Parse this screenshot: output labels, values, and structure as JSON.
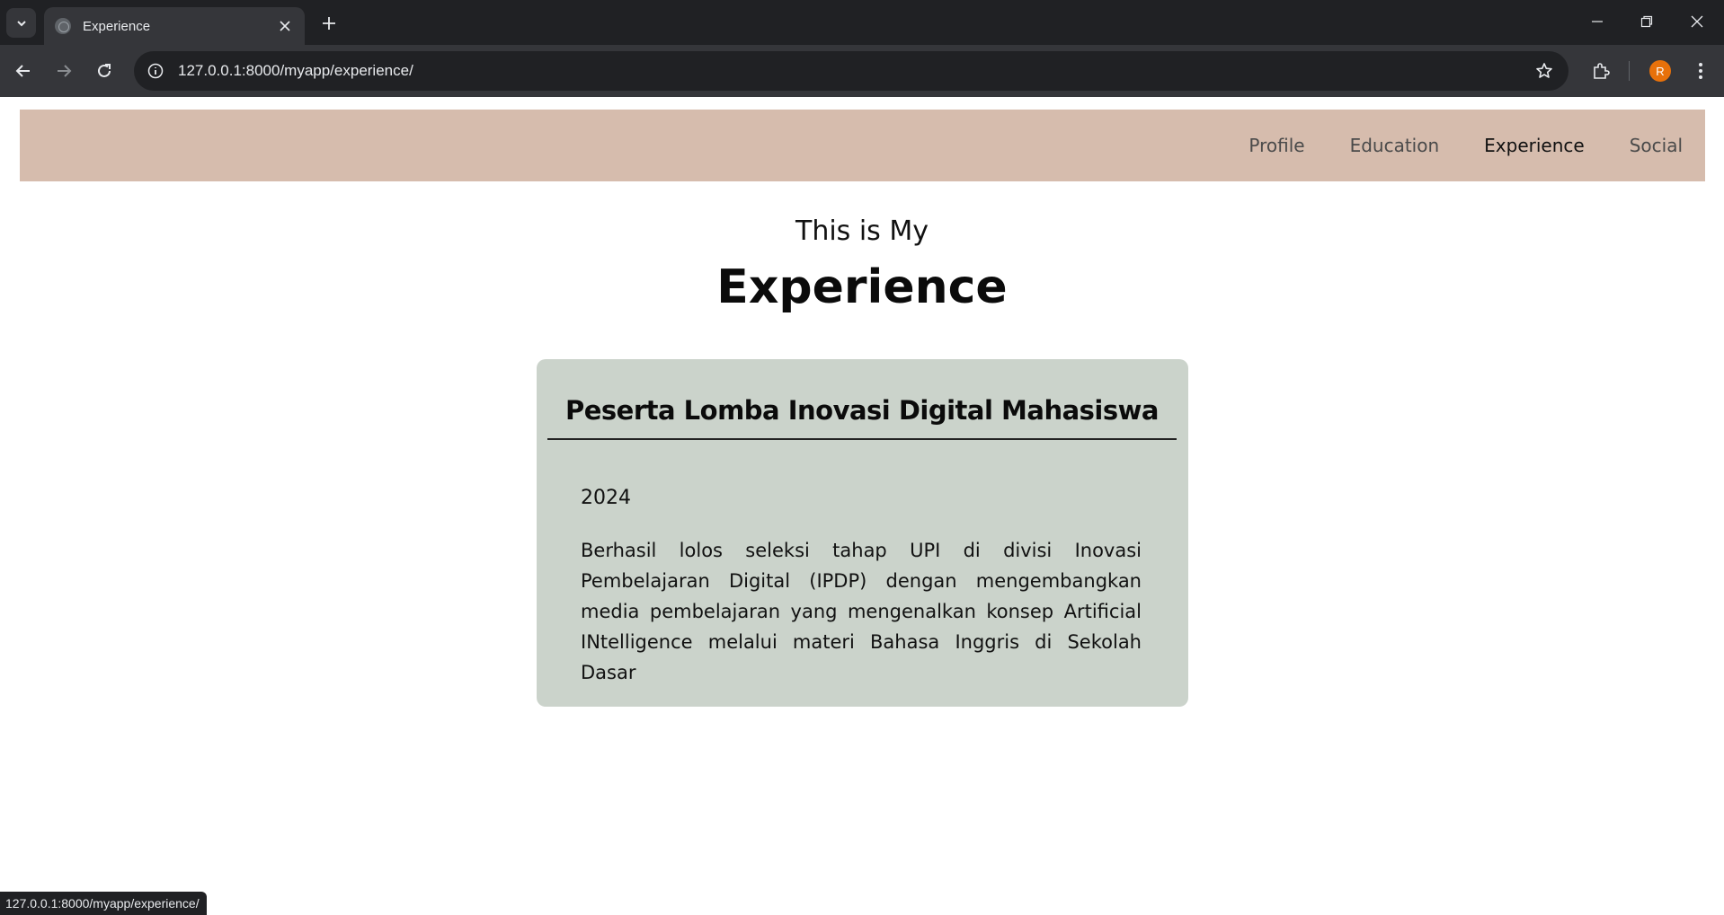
{
  "browser": {
    "tab_title": "Experience",
    "url": "127.0.0.1:8000/myapp/experience/",
    "avatar_initial": "R",
    "status_url": "127.0.0.1:8000/myapp/experience/"
  },
  "nav": {
    "items": [
      {
        "label": "Profile"
      },
      {
        "label": "Education"
      },
      {
        "label": "Experience",
        "active": true
      },
      {
        "label": "Social"
      }
    ],
    "background": "#d6bcad"
  },
  "heading": {
    "subtitle": "This is My",
    "title": "Experience"
  },
  "experience": {
    "title": "Peserta Lomba Inovasi Digital Mahasiswa",
    "year": "2024",
    "description": "Berhasil lolos seleksi tahap UPI di divisi Inovasi Pembelajaran Digital (IPDP) dengan mengembangkan media pembelajaran yang mengenalkan konsep Artificial INtelligence melalui materi Bahasa Inggris di Sekolah Dasar",
    "card_color": "#cbd3cb"
  }
}
